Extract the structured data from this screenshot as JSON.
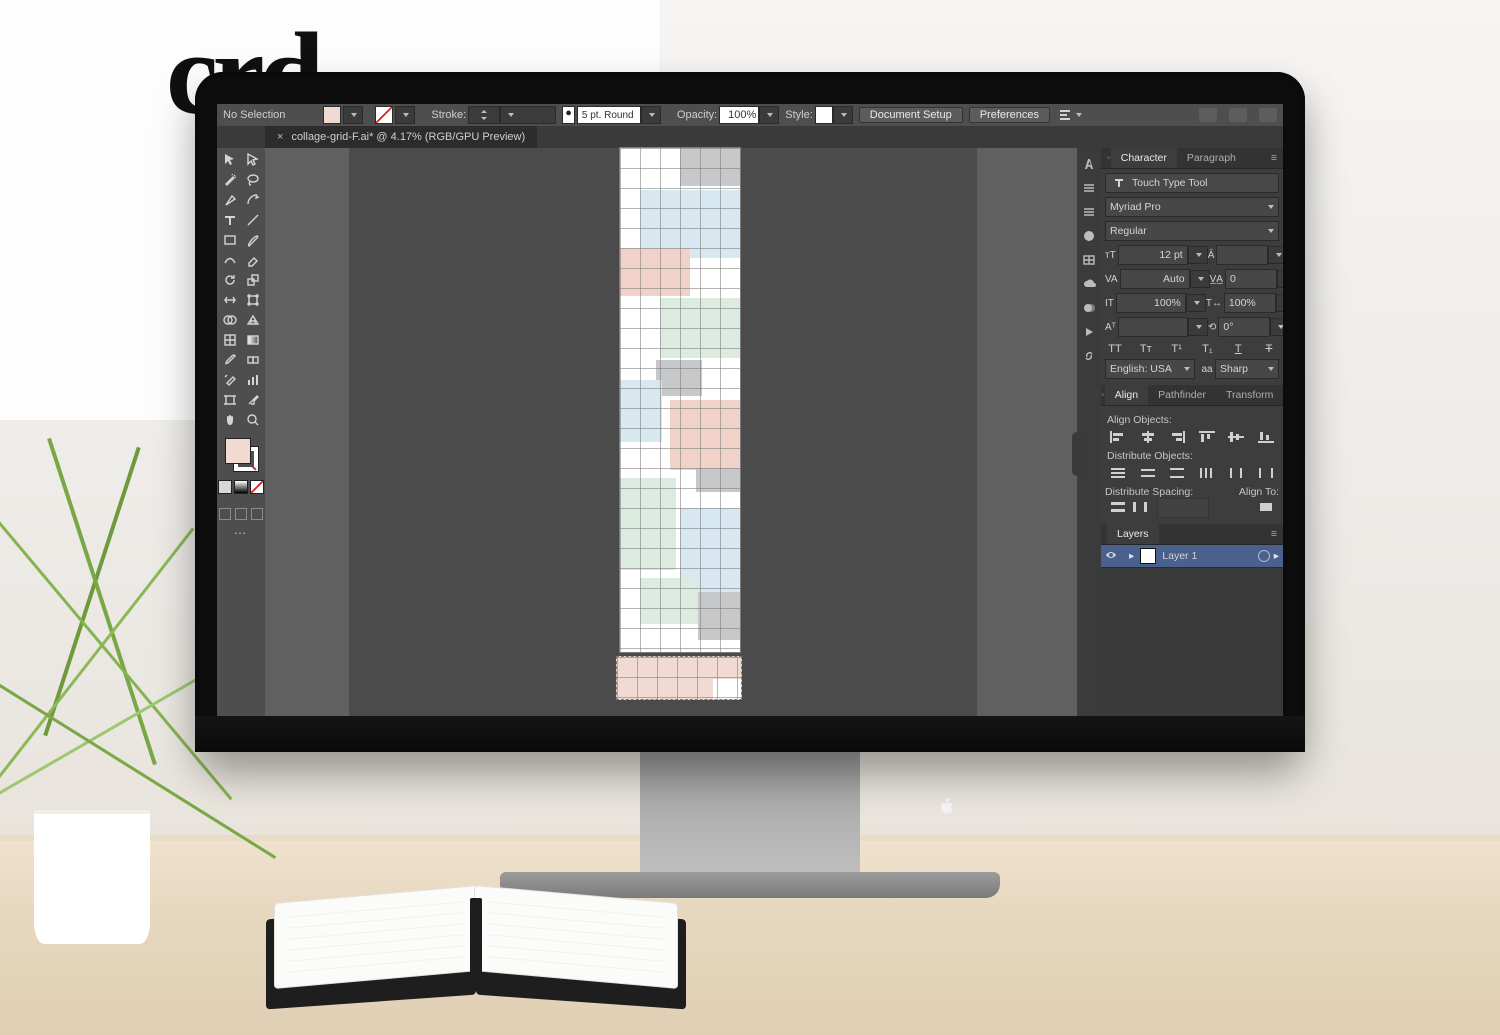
{
  "wordmark": "crd",
  "control": {
    "selection_status": "No Selection",
    "fill_swatch": "#f1dad1",
    "stroke_label": "Stroke:",
    "stroke_profile": "5 pt. Round",
    "opacity_label": "Opacity:",
    "opacity_value": "100%",
    "style_label": "Style:",
    "buttons": {
      "doc_setup": "Document Setup",
      "prefs": "Preferences"
    }
  },
  "document": {
    "tab_title": "collage-grid-F.ai* @ 4.17% (RGB/GPU Preview)"
  },
  "panels": {
    "character": {
      "tab_char": "Character",
      "tab_para": "Paragraph",
      "touch_type": "Touch Type Tool",
      "font_family": "Myriad Pro",
      "font_style": "Regular",
      "font_size": "12 pt",
      "leading": "",
      "kerning": "Auto",
      "tracking": "0",
      "vscale": "100%",
      "hscale": "100%",
      "baseline": "",
      "rotation": "0°",
      "language_label": "English: USA",
      "antialias_lbl": "aa",
      "antialias": "Sharp"
    },
    "align": {
      "tab_align": "Align",
      "tab_pathfinder": "Pathfinder",
      "tab_transform": "Transform",
      "sec_align_objects": "Align Objects:",
      "sec_distribute": "Distribute Objects:",
      "sec_spacing": "Distribute Spacing:",
      "align_to": "Align To:"
    },
    "layers": {
      "tab": "Layers",
      "items": [
        {
          "name": "Layer 1"
        }
      ]
    }
  }
}
